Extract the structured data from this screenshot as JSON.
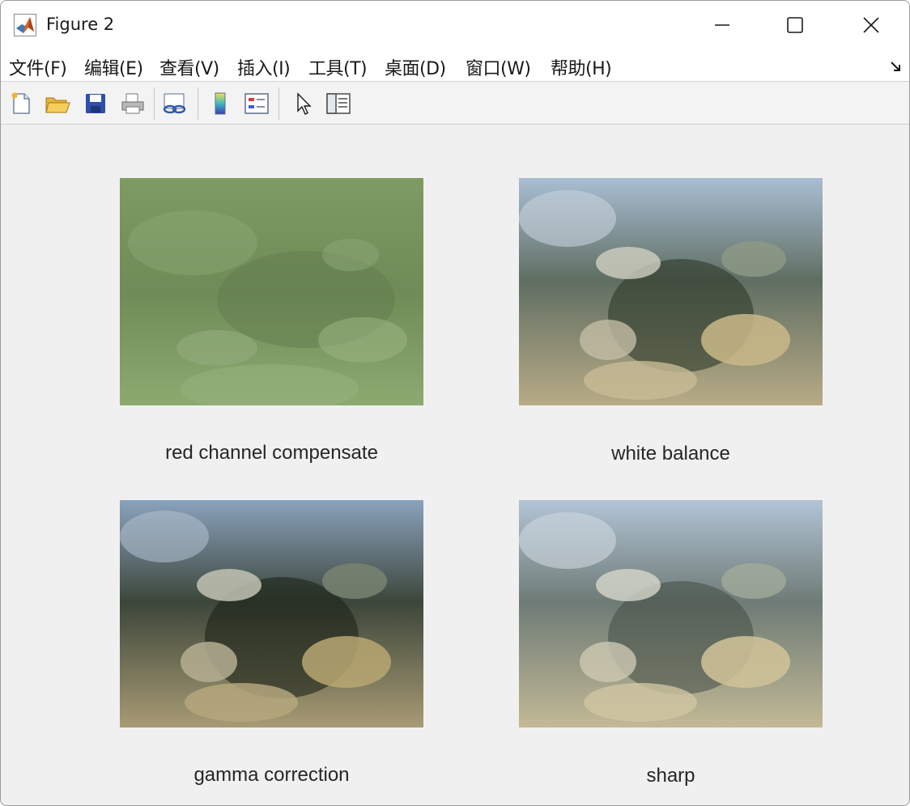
{
  "window": {
    "title": "Figure 2"
  },
  "menu": {
    "items": [
      {
        "label": "文件(F)"
      },
      {
        "label": "编辑(E)"
      },
      {
        "label": "查看(V)"
      },
      {
        "label": "插入(I)"
      },
      {
        "label": "工具(T)"
      },
      {
        "label": "桌面(D)"
      },
      {
        "label": "窗口(W)"
      },
      {
        "label": "帮助(H)"
      }
    ]
  },
  "toolbar": {
    "buttons": [
      "new-figure-icon",
      "open-file-icon",
      "save-icon",
      "print-icon",
      "link-plot-icon",
      "colorbar-icon",
      "legend-icon",
      "edit-plot-pointer-icon",
      "property-inspector-icon"
    ]
  },
  "subplots": [
    {
      "title": "red channel compensate",
      "tint": "#7f9c68"
    },
    {
      "title": "white balance",
      "tint": "#8fa2b6"
    },
    {
      "title": "gamma correction",
      "tint": "#6f8193"
    },
    {
      "title": "sharp",
      "tint": "#9aa8b8"
    }
  ]
}
